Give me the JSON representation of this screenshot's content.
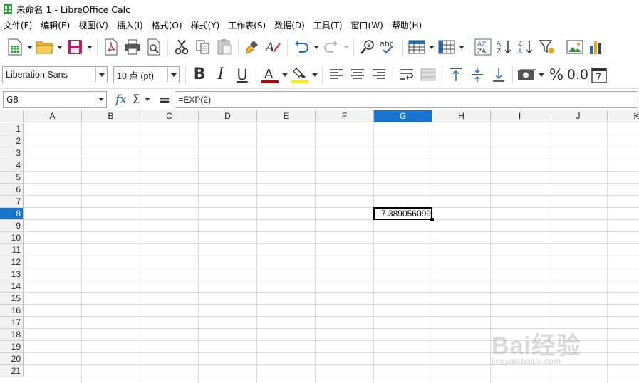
{
  "window": {
    "title": "未命名 1 - LibreOffice Calc"
  },
  "menu": [
    "文件(F)",
    "编辑(E)",
    "视图(V)",
    "插入(I)",
    "格式(O)",
    "样式(Y)",
    "工作表(S)",
    "数据(D)",
    "工具(T)",
    "窗口(W)",
    "帮助(H)"
  ],
  "formatting": {
    "font_name": "Liberation Sans",
    "font_size": "10 点 (pt)",
    "percent": "%",
    "decimal": "0.0"
  },
  "formula_bar": {
    "name_box": "G8",
    "formula": "=EXP(2)"
  },
  "columns": [
    "A",
    "B",
    "C",
    "D",
    "E",
    "F",
    "G",
    "H",
    "I",
    "J",
    "K"
  ],
  "rows": [
    "1",
    "2",
    "3",
    "4",
    "5",
    "6",
    "7",
    "8",
    "9",
    "10",
    "11",
    "12",
    "13",
    "14",
    "15",
    "16",
    "17",
    "18",
    "19",
    "20",
    "21"
  ],
  "active_cell": {
    "column": "G",
    "row": "8",
    "value": "7.389056099"
  },
  "colors": {
    "accent": "#1b74cc",
    "font_color": "#c00000",
    "highlight": "#ffee00",
    "app_icon": "#2e9c3b"
  },
  "watermark": {
    "text": "Bai经验",
    "sub": "jingyan.baidu.com"
  }
}
